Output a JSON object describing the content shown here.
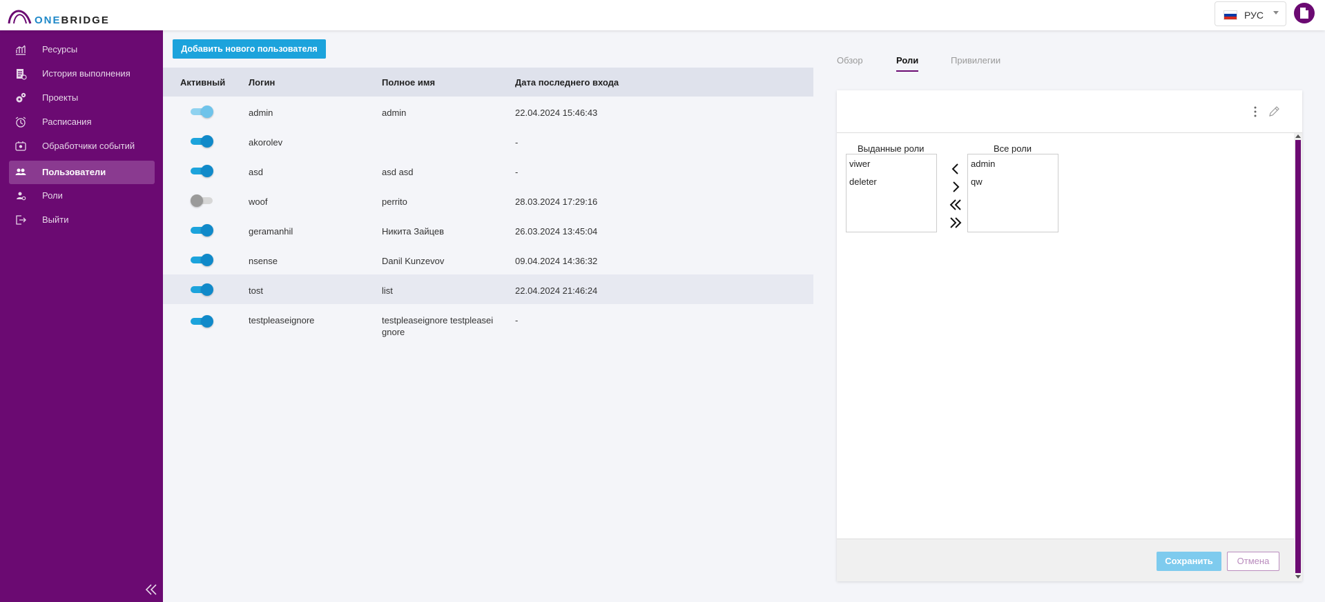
{
  "app": {
    "logo_one": "ONE",
    "logo_bridge": "BRIDGE"
  },
  "header": {
    "lang_label": "РУС",
    "flag_colors": [
      "#ffffff",
      "#0039a6",
      "#d52b1e"
    ]
  },
  "sidebar": {
    "items": [
      {
        "label": "Ресурсы",
        "icon": "chart-icon"
      },
      {
        "label": "История выполнения",
        "icon": "history-icon"
      },
      {
        "label": "Проекты",
        "icon": "gears-icon"
      },
      {
        "label": "Расписания",
        "icon": "alarm-clock-icon"
      },
      {
        "label": "Обработчики событий",
        "icon": "event-handler-icon"
      },
      {
        "label": "Пользователи",
        "icon": "users-icon",
        "active": true
      },
      {
        "label": "Роли",
        "icon": "roles-icon"
      },
      {
        "label": "Выйти",
        "icon": "logout-icon"
      }
    ]
  },
  "main": {
    "add_user_label": "Добавить нового пользователя",
    "table": {
      "headers": [
        "Активный",
        "Логин",
        "Полное имя",
        "Дата последнего входа"
      ],
      "rows": [
        {
          "active": "light",
          "login": "admin",
          "full_name": "admin",
          "last_login": "22.04.2024 15:46:43"
        },
        {
          "active": "on",
          "login": "akorolev",
          "full_name": "",
          "last_login": "-"
        },
        {
          "active": "on",
          "login": "asd",
          "full_name": "asd asd",
          "last_login": "-"
        },
        {
          "active": "off",
          "login": "woof",
          "full_name": "perrito",
          "last_login": "28.03.2024 17:29:16"
        },
        {
          "active": "on",
          "login": "geramanhil",
          "full_name": "Никита Зайцев",
          "last_login": "26.03.2024 13:45:04"
        },
        {
          "active": "on",
          "login": "nsense",
          "full_name": "Danil Kunzevov",
          "last_login": "09.04.2024 14:36:32"
        },
        {
          "active": "on",
          "login": "tost",
          "full_name": "list",
          "last_login": "22.04.2024 21:46:24",
          "highlight": true
        },
        {
          "active": "on",
          "login": "testpleaseignore",
          "full_name_line1": "testpleaseignore testpleasei",
          "full_name_line2": "gnore",
          "last_login": "-"
        }
      ]
    }
  },
  "panel": {
    "tabs": [
      {
        "label": "Обзор"
      },
      {
        "label": "Роли",
        "active": true
      },
      {
        "label": "Привилегии"
      }
    ],
    "assigned_title": "Выданные роли",
    "all_title": "Все роли",
    "assigned_roles": [
      "viwer",
      "deleter"
    ],
    "all_roles": [
      "admin",
      "qw"
    ],
    "save_label": "Сохранить",
    "cancel_label": "Отмена"
  },
  "colors": {
    "brand": "#6b0a72",
    "accent": "#1ca3dc",
    "toggle_on": "#1089c9"
  }
}
